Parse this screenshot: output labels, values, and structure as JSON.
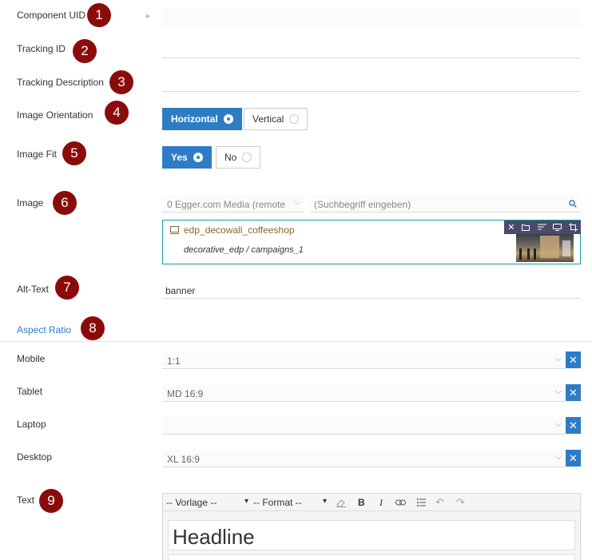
{
  "fields": {
    "component_uid": {
      "label": "Component UID",
      "badge": "1",
      "value": ""
    },
    "tracking_id": {
      "label": "Tracking ID",
      "badge": "2",
      "value": ""
    },
    "tracking_description": {
      "label": "Tracking Description",
      "badge": "3",
      "value": ""
    },
    "image_orientation": {
      "label": "Image Orientation",
      "badge": "4",
      "options": [
        "Horizontal",
        "Vertical"
      ],
      "selected": "Horizontal"
    },
    "image_fit": {
      "label": "Image Fit",
      "badge": "5",
      "options": [
        "Yes",
        "No"
      ],
      "selected": "Yes"
    },
    "image": {
      "label": "Image",
      "badge": "6",
      "source_select": "0 Egger.com Media (remote",
      "search_placeholder": "(Suchbegriff eingeben)",
      "asset_name": "edp_decowall_coffeeshop",
      "asset_path": "decorative_edp / campaigns_1"
    },
    "alt_text": {
      "label": "Alt-Text",
      "badge": "7",
      "value": "banner"
    },
    "aspect_ratio": {
      "label": "Aspect Ratio",
      "badge": "8"
    },
    "text": {
      "label": "Text",
      "badge": "9"
    }
  },
  "aspect_ratio_rows": [
    {
      "label": "Mobile",
      "value": "1:1"
    },
    {
      "label": "Tablet",
      "value": "MD 16:9"
    },
    {
      "label": "Laptop",
      "value": ""
    },
    {
      "label": "Desktop",
      "value": "XL 16:9"
    }
  ],
  "editor": {
    "template_select": "-- Vorlage --",
    "format_select": "-- Format --",
    "headline": "Headline"
  },
  "colors": {
    "accent": "#2e7cc6",
    "badge": "#8b0b0b",
    "asset_border": "#1a9fa0",
    "asset_title": "#8a6a2a",
    "asset_toolbar": "#4a4a6a"
  }
}
